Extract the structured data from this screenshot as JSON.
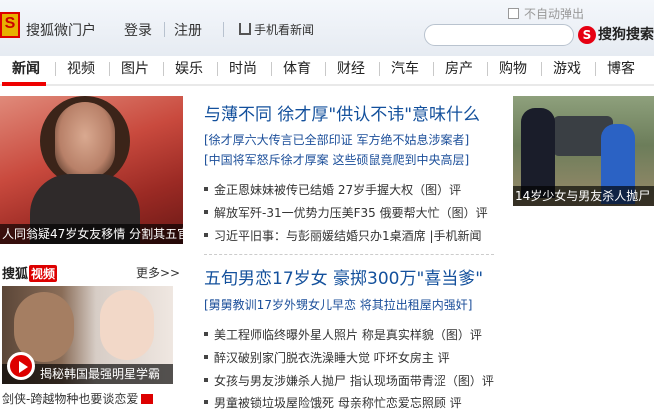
{
  "header": {
    "brand": "搜狐微门户",
    "login": "登录",
    "register": "注册",
    "mobile_news": "手机看新闻",
    "auto_popup": "不自动弹出",
    "search_placeholder": "",
    "sogou_search": "搜狗搜索"
  },
  "nav": {
    "items": [
      "新闻",
      "视频",
      "图片",
      "娱乐",
      "时尚",
      "体育",
      "财经",
      "汽车",
      "房产",
      "购物",
      "游戏",
      "博客"
    ],
    "active": "新闻"
  },
  "left_photo_caption": "人同翁疑47岁女友移情 分割其五官",
  "right_photo_caption": "14岁少女与男友杀人抛尸",
  "video": {
    "brand": "搜狐",
    "badge": "视频",
    "more": "更多>>",
    "caption": "揭秘韩国最强明星学霸",
    "sub": "剑侠-跨越物种也要谈恋爱"
  },
  "news_block_1": {
    "headline": "与薄不同 徐才厚\"供认不讳\"意味什么",
    "sub1": "[徐才厚六大传言已全部印证 军方绝不姑息涉案者]",
    "sub2": "[中国将军怒斥徐才厚案 这些硕鼠竟爬到中央高层]",
    "items": [
      "金正恩妹妹被传已结婚 27岁手握大权（图）评",
      "解放军歼-31一优势力压美F35 俄要帮大忙（图）评",
      "习近平旧事：与彭丽媛结婚只办1桌酒席 |手机新闻"
    ]
  },
  "news_block_2": {
    "headline": "五旬男恋17岁女 豪掷300万\"喜当爹\"",
    "sub1": "[舅舅教训17岁外甥女儿早恋 将其拉出租屋内强奸]",
    "items": [
      "美工程师临终曝外星人照片 称是真实样貌（图）评",
      "醉汉破别家门脱衣洗澡睡大觉 吓坏女房主 评",
      "女孩与男友涉嫌杀人抛尸 指认现场面带青涩（图）评",
      "男童被锁垃圾屋险饿死 母亲称忙恋爱忘照顾 评"
    ]
  },
  "colors": {
    "headline": "#13509c",
    "accent_red": "#dd0000"
  }
}
